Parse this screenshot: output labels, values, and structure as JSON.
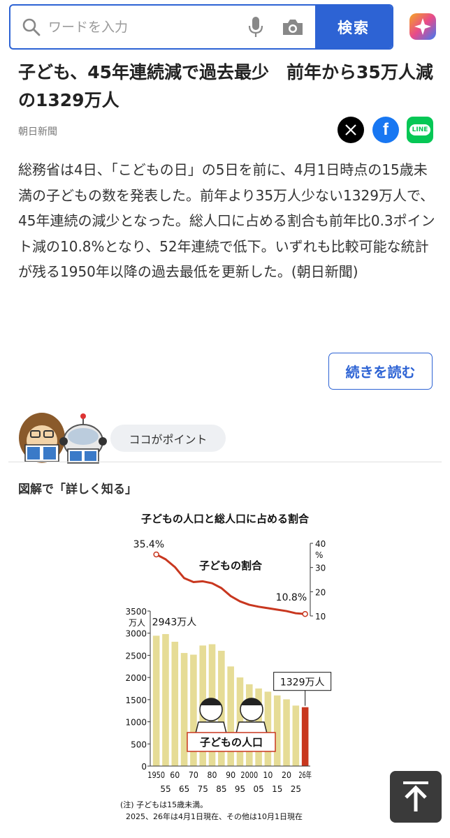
{
  "search": {
    "placeholder": "ワードを入力",
    "button_label": "検索"
  },
  "article": {
    "title": "子ども、45年連続減で過去最少　前年から35万人減の1329万人",
    "source": "朝日新聞",
    "body": "総務省は4日、「こどもの日」の5日を前に、4月1日時点の15歳未満の子どもの数を発表した。前年より35万人少ない1329万人で、45年連続の減少となった。総人口に占める割合も前年比0.3ポイント減の10.8%となり、52年連続で低下。いずれも比較可能な統計が残る1950年以降の過去最低を更新した。(朝日新聞)",
    "read_more": "続きを読む"
  },
  "share": {
    "x": "X",
    "facebook": "f",
    "line": "LINE"
  },
  "point_label": "ココがポイント",
  "section_title": "図解で「詳しく知る」",
  "chart_data": {
    "type": "bar+line",
    "title": "子どもの人口と総人口に占める割合",
    "bars_label": "子どもの人口",
    "line_label": "子どもの割合",
    "left_unit": "万人",
    "right_unit": "%",
    "left_ylim": [
      0,
      3500
    ],
    "right_ylim": [
      10,
      40
    ],
    "left_ticks": [
      0,
      500,
      1000,
      1500,
      2000,
      2500,
      3000,
      3500
    ],
    "right_ticks": [
      10,
      20,
      30,
      40
    ],
    "x_top_labels": [
      "1950",
      "60",
      "70",
      "80",
      "90",
      "2000",
      "10",
      "20",
      "26年"
    ],
    "x_bottom_labels": [
      "55",
      "65",
      "75",
      "85",
      "95",
      "05",
      "15",
      "25"
    ],
    "x": [
      1950,
      1955,
      1960,
      1965,
      1970,
      1975,
      1980,
      1985,
      1990,
      1995,
      2000,
      2005,
      2010,
      2015,
      2020,
      2025,
      2026
    ],
    "population": [
      2943,
      2980,
      2807,
      2553,
      2515,
      2722,
      2751,
      2603,
      2249,
      2001,
      1847,
      1752,
      1680,
      1595,
      1507,
      1366,
      1329
    ],
    "ratio": [
      35.4,
      33.4,
      30.2,
      25.6,
      24.0,
      24.3,
      23.5,
      21.5,
      18.2,
      16.0,
      14.6,
      13.8,
      13.2,
      12.6,
      12.0,
      11.1,
      10.8
    ],
    "annotations": {
      "first_value": "2943万人",
      "last_value": "1329万人",
      "first_ratio": "35.4%",
      "last_ratio": "10.8%"
    },
    "note1": "(注) 子どもは15歳未満。",
    "note2": "2025、26年は4月1日現在、その他は10月1日現在",
    "colors": {
      "bar": "#e6dc96",
      "last_bar": "#c8371f",
      "line": "#c8371f"
    }
  }
}
